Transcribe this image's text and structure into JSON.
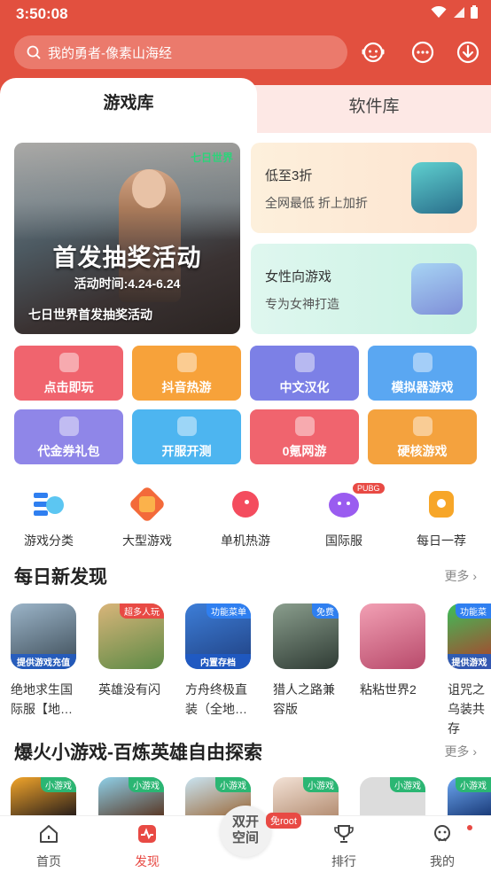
{
  "status": {
    "time": "3:50:08"
  },
  "search": {
    "placeholder": "我的勇者-像素山海经"
  },
  "tabs": {
    "active": "游戏库",
    "inactive": "软件库"
  },
  "banner": {
    "brand": "七日世界",
    "title": "首发抽奖活动",
    "date": "活动时间:4.24-6.24",
    "caption": "七日世界首发抽奖活动"
  },
  "promos": [
    {
      "title": "低至3折",
      "subtitle": "全网最低 折上加折"
    },
    {
      "title": "女性向游戏",
      "subtitle": "专为女神打造"
    }
  ],
  "categories": [
    {
      "label": "点击即玩",
      "color": "#f0646e"
    },
    {
      "label": "抖音热游",
      "color": "#f7a23a"
    },
    {
      "label": "中文汉化",
      "color": "#7c80e6"
    },
    {
      "label": "模拟器游戏",
      "color": "#5aa7f2"
    },
    {
      "label": "代金券礼包",
      "color": "#8f86e8"
    },
    {
      "label": "开服开测",
      "color": "#4db5f0"
    },
    {
      "label": "0氪网游",
      "color": "#f0646e"
    },
    {
      "label": "硬核游戏",
      "color": "#f4a23e"
    }
  ],
  "quicknav": [
    {
      "label": "游戏分类"
    },
    {
      "label": "大型游戏"
    },
    {
      "label": "单机热游"
    },
    {
      "label": "国际服",
      "badge": "PUBG"
    },
    {
      "label": "每日一荐"
    }
  ],
  "daily": {
    "title": "每日新发现",
    "more": "更多",
    "games": [
      {
        "name": "绝地求生国际服【地…",
        "bottom": "提供游戏充值"
      },
      {
        "name": "英雄没有闪",
        "tag": "超多人玩"
      },
      {
        "name": "方舟终极直装（全地…",
        "tag": "功能菜单",
        "bottom": "内置存档"
      },
      {
        "name": "猎人之路兼容版",
        "tag": "免费"
      },
      {
        "name": "粘粘世界2"
      },
      {
        "name": "诅咒之乌装共存",
        "tag": "功能菜",
        "bottom": "提供游戏"
      }
    ]
  },
  "mini": {
    "title": "爆火小游戏-百炼英雄自由探索",
    "more": "更多",
    "tag": "小游戏"
  },
  "nav": {
    "home": "首页",
    "discover": "发现",
    "center_line1": "双开",
    "center_line2": "空间",
    "free_badge": "免root",
    "rank": "排行",
    "me": "我的"
  }
}
